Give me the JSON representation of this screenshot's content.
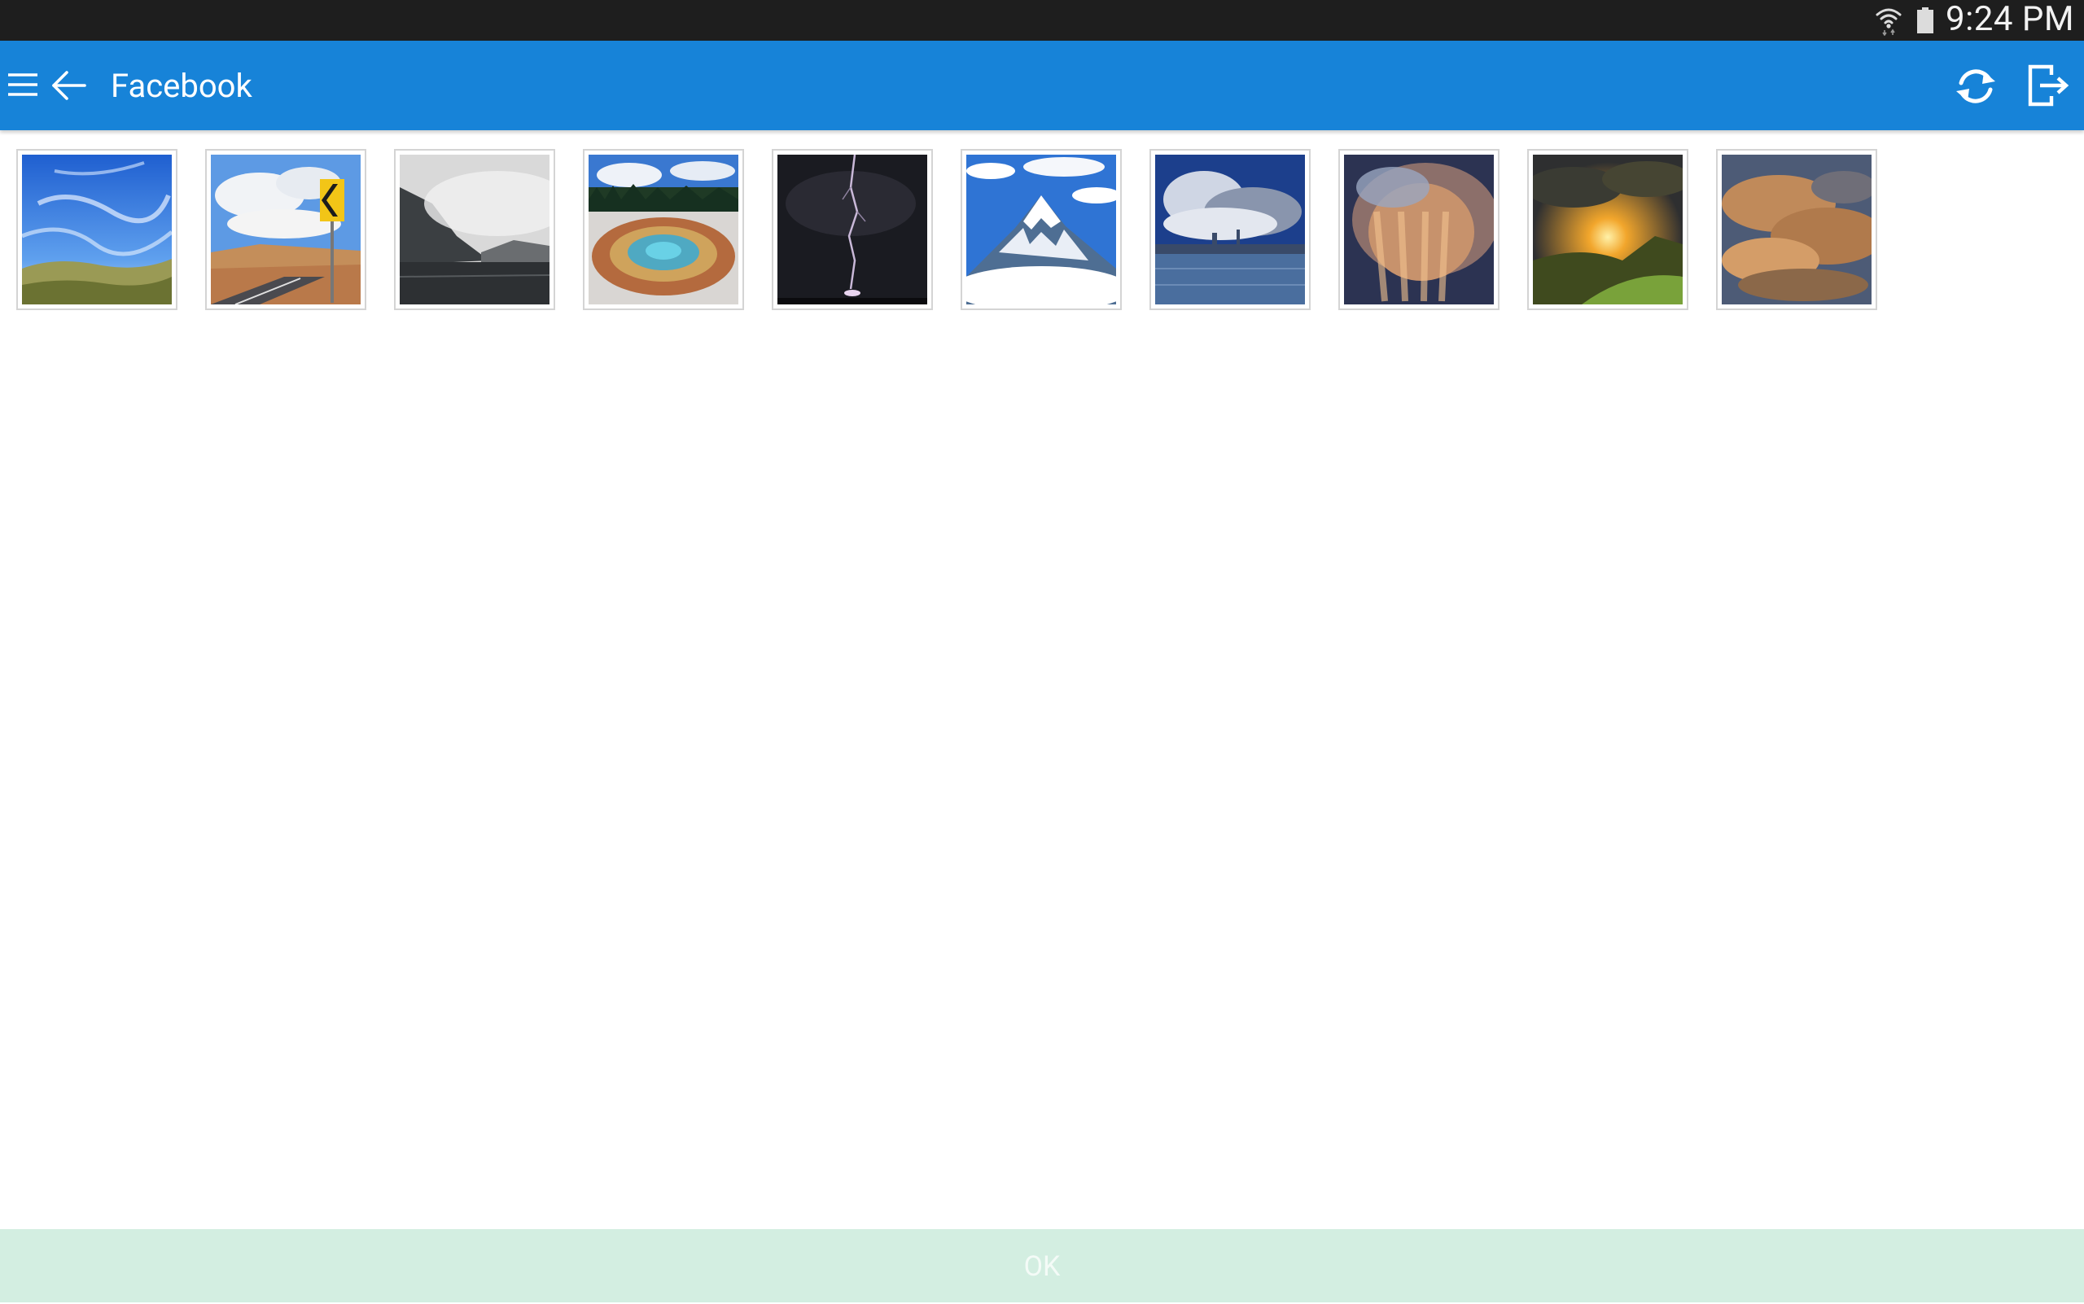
{
  "status_bar": {
    "time": "9:24 PM",
    "icons": [
      "wifi-icon",
      "battery-icon"
    ]
  },
  "app_bar": {
    "title": "Facebook",
    "background_color": "#1783d8",
    "icons": [
      "menu-icon",
      "back-arrow-icon",
      "refresh-icon",
      "logout-icon"
    ]
  },
  "photos": [
    {
      "name": "photo-blue-sky-grass"
    },
    {
      "name": "photo-desert-road-sign"
    },
    {
      "name": "photo-misty-mountain-lake"
    },
    {
      "name": "photo-hot-spring"
    },
    {
      "name": "photo-lightning-night"
    },
    {
      "name": "photo-snow-mountain-clouds"
    },
    {
      "name": "photo-city-storm-clouds"
    },
    {
      "name": "photo-golden-storm-cloud"
    },
    {
      "name": "photo-sunset-hills"
    },
    {
      "name": "photo-orange-clouds"
    }
  ],
  "footer": {
    "ok_label": "OK",
    "background_color": "#d3eee1"
  }
}
